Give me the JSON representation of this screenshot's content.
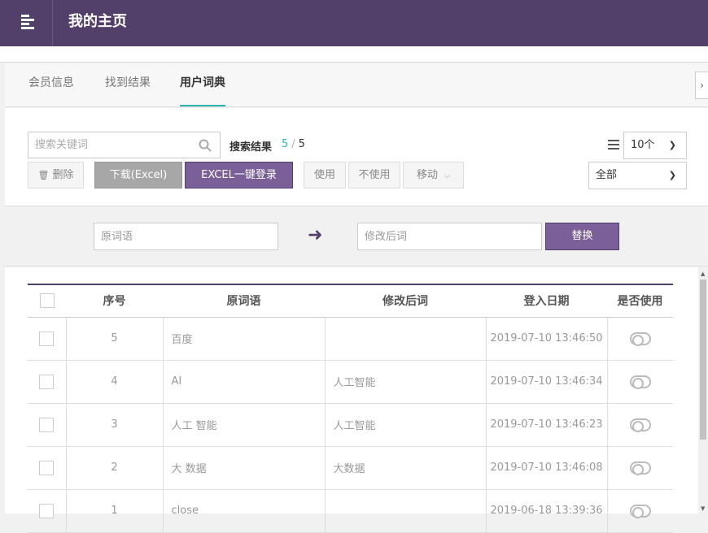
{
  "header": {
    "title": "我的主页"
  },
  "tabs": [
    {
      "label": "会员信息"
    },
    {
      "label": "找到结果"
    },
    {
      "label": "用户词典"
    }
  ],
  "search": {
    "placeholder": "搜索关键词",
    "result_label": "搜索结果",
    "result_current": "5",
    "result_total": "5"
  },
  "toolbar": {
    "delete_label": "删除",
    "download_label": "下载(Excel)",
    "excel_login_label": "EXCEL一键登录",
    "use_label": "使用",
    "unuse_label": "不使用",
    "move_label": "移动",
    "page_size": "10个",
    "filter": "全部"
  },
  "replace": {
    "original_placeholder": "原词语",
    "modified_placeholder": "修改后词",
    "button_label": "替换"
  },
  "table": {
    "headers": [
      "序号",
      "原词语",
      "修改后词",
      "登入日期",
      "是否使用"
    ],
    "rows": [
      {
        "no": "5",
        "original": "百度",
        "modified": "",
        "date": "2019-07-10 13:46:50"
      },
      {
        "no": "4",
        "original": "AI",
        "modified": "人工智能",
        "date": "2019-07-10 13:46:34"
      },
      {
        "no": "3",
        "original": "人工 智能",
        "modified": "人工智能",
        "date": "2019-07-10 13:46:23"
      },
      {
        "no": "2",
        "original": "大 数据",
        "modified": "大数据",
        "date": "2019-07-10 13:46:08"
      },
      {
        "no": "1",
        "original": "close",
        "modified": "",
        "date": "2019-06-18 13:39:36"
      }
    ]
  },
  "colors": {
    "header_bg": "#52406b",
    "accent": "#7b5f99",
    "tab_active": "#2bb5b0"
  }
}
